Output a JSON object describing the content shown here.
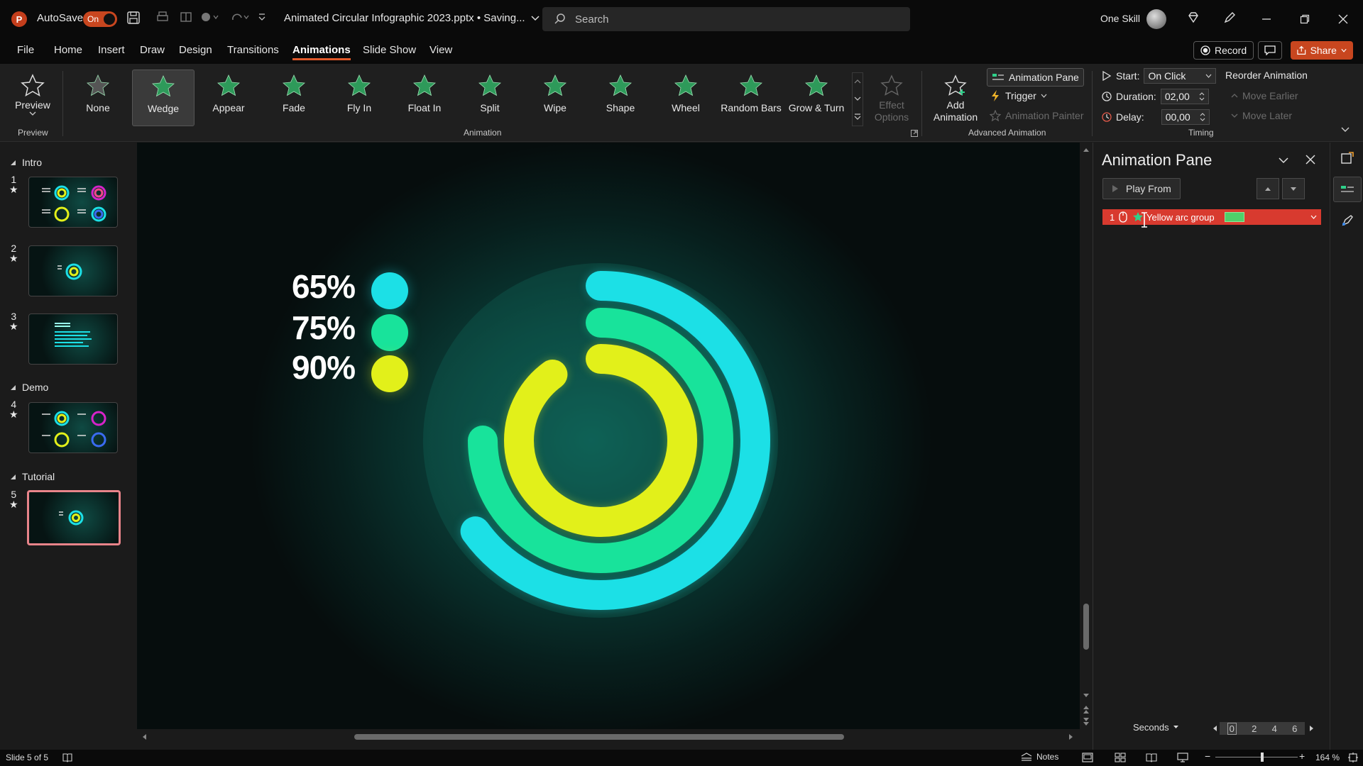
{
  "titlebar": {
    "autosave_label": "AutoSave",
    "autosave_state": "On",
    "document_title": "Animated Circular Infographic 2023.pptx • Saving...",
    "search_placeholder": "Search",
    "account_name": "One Skill"
  },
  "menu": {
    "items": [
      "File",
      "Home",
      "Insert",
      "Draw",
      "Design",
      "Transitions",
      "Animations",
      "Slide Show",
      "View"
    ],
    "active": "Animations",
    "record_label": "Record",
    "share_label": "Share"
  },
  "ribbon": {
    "preview_label": "Preview",
    "preview_group": "Preview",
    "animations": [
      "None",
      "Wedge",
      "Appear",
      "Fade",
      "Fly In",
      "Float In",
      "Split",
      "Wipe",
      "Shape",
      "Wheel",
      "Random Bars",
      "Grow & Turn"
    ],
    "selected_animation": "Wedge",
    "effect_options_label": "Effect Options",
    "animation_group": "Animation",
    "add_animation_label": "Add Animation",
    "animation_pane_label": "Animation Pane",
    "trigger_label": "Trigger",
    "animation_painter_label": "Animation Painter",
    "advanced_group": "Advanced Animation",
    "start_label": "Start:",
    "start_value": "On Click",
    "duration_label": "Duration:",
    "duration_value": "02,00",
    "delay_label": "Delay:",
    "delay_value": "00,00",
    "reorder_label": "Reorder Animation",
    "move_earlier_label": "Move Earlier",
    "move_later_label": "Move Later",
    "timing_group": "Timing"
  },
  "thumbnails": {
    "sections": [
      "Intro",
      "Demo",
      "Tutorial"
    ],
    "slides": [
      "1",
      "2",
      "3",
      "4",
      "5"
    ],
    "selected": "5"
  },
  "slide": {
    "items": [
      {
        "label": "65%",
        "color": "#1ce0e6"
      },
      {
        "label": "75%",
        "color": "#18e39b"
      },
      {
        "label": "90%",
        "color": "#e2f01a"
      }
    ],
    "chart_data": {
      "type": "radial-bar",
      "values": [
        65,
        75,
        90
      ],
      "colors": [
        "#1ce0e6",
        "#18e39b",
        "#e2f01a"
      ]
    }
  },
  "animation_pane": {
    "title": "Animation Pane",
    "play_from_label": "Play From",
    "entry_number": "1",
    "entry_label": "Yellow arc group",
    "timeline_unit": "Seconds",
    "timeline_ticks": [
      "0",
      "2",
      "4",
      "6"
    ]
  },
  "statusbar": {
    "slide_indicator": "Slide 5 of 5",
    "notes_label": "Notes",
    "zoom_value": "164 %"
  },
  "colors": {
    "accent": "#c8461f",
    "selected_anim_entry": "#d83a2f"
  }
}
